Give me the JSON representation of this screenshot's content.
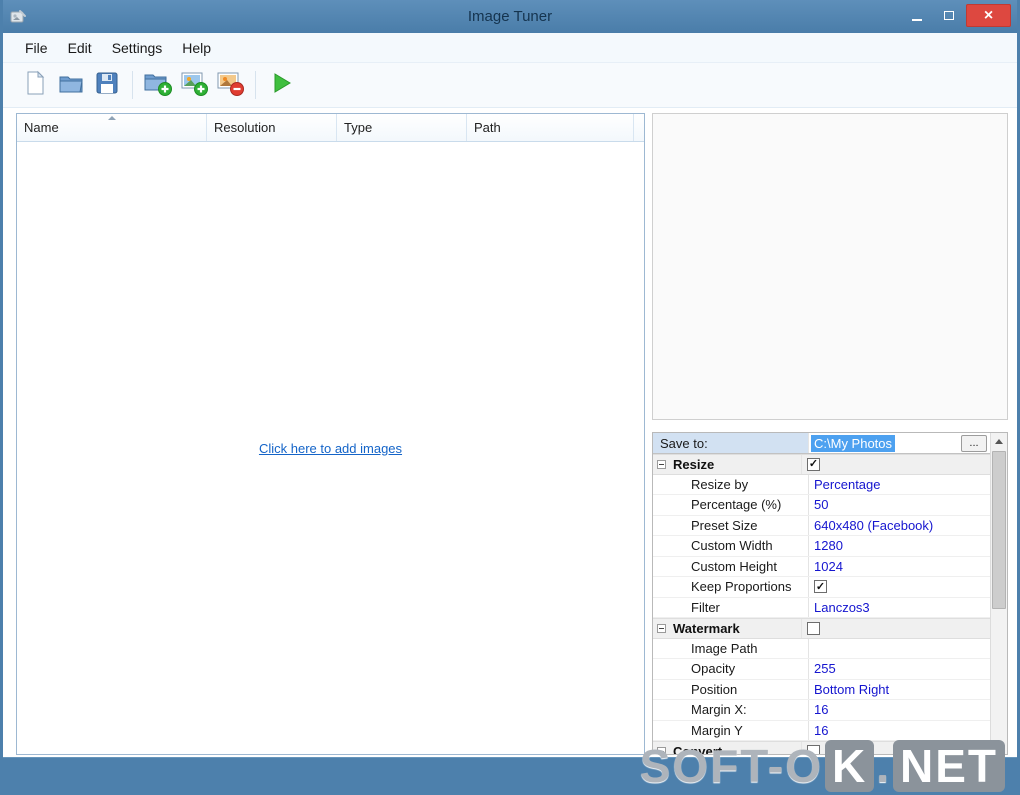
{
  "window": {
    "title": "Image Tuner",
    "controls": {
      "close_glyph": "×"
    }
  },
  "menu": {
    "items": [
      {
        "label": "File"
      },
      {
        "label": "Edit"
      },
      {
        "label": "Settings"
      },
      {
        "label": "Help"
      }
    ]
  },
  "toolbar": {
    "buttons": [
      {
        "icon": "new-document-icon"
      },
      {
        "icon": "open-folder-icon"
      },
      {
        "icon": "save-icon"
      },
      {
        "icon": "add-folder-icon"
      },
      {
        "icon": "add-images-icon"
      },
      {
        "icon": "remove-image-icon"
      },
      {
        "icon": "run-process-icon"
      }
    ]
  },
  "file_list": {
    "columns": [
      {
        "label": "Name"
      },
      {
        "label": "Resolution"
      },
      {
        "label": "Type"
      },
      {
        "label": "Path"
      }
    ],
    "empty_state_link": "Click here to add images",
    "sort": {
      "column": "Name",
      "direction": "ascending"
    }
  },
  "settings": {
    "save_to": {
      "label": "Save to:",
      "value": "C:\\My Photos",
      "browse_label": "...",
      "value_selected": true
    },
    "groups": [
      {
        "label": "Resize",
        "enabled": true,
        "rows": [
          {
            "label": "Resize by",
            "value": "Percentage"
          },
          {
            "label": "Percentage (%)",
            "value": "50"
          },
          {
            "label": "Preset Size",
            "value": "640x480 (Facebook)"
          },
          {
            "label": "Custom Width",
            "value": "1280"
          },
          {
            "label": "Custom Height",
            "value": "1024"
          },
          {
            "label": "Keep Proportions",
            "value": "",
            "checked": true
          },
          {
            "label": "Filter",
            "value": "Lanczos3"
          }
        ]
      },
      {
        "label": "Watermark",
        "enabled": false,
        "rows": [
          {
            "label": "Image Path",
            "value": ""
          },
          {
            "label": "Opacity",
            "value": "255"
          },
          {
            "label": "Position",
            "value": "Bottom Right"
          },
          {
            "label": "Margin X:",
            "value": "16"
          },
          {
            "label": "Margin Y",
            "value": "16"
          }
        ]
      },
      {
        "label": "Convert",
        "enabled": false,
        "rows": []
      }
    ],
    "accent_value_color": "#1515cf"
  },
  "site_watermark": {
    "part1": "SOFT-O",
    "part2": "K",
    "part3": ".",
    "part4": "NET"
  }
}
